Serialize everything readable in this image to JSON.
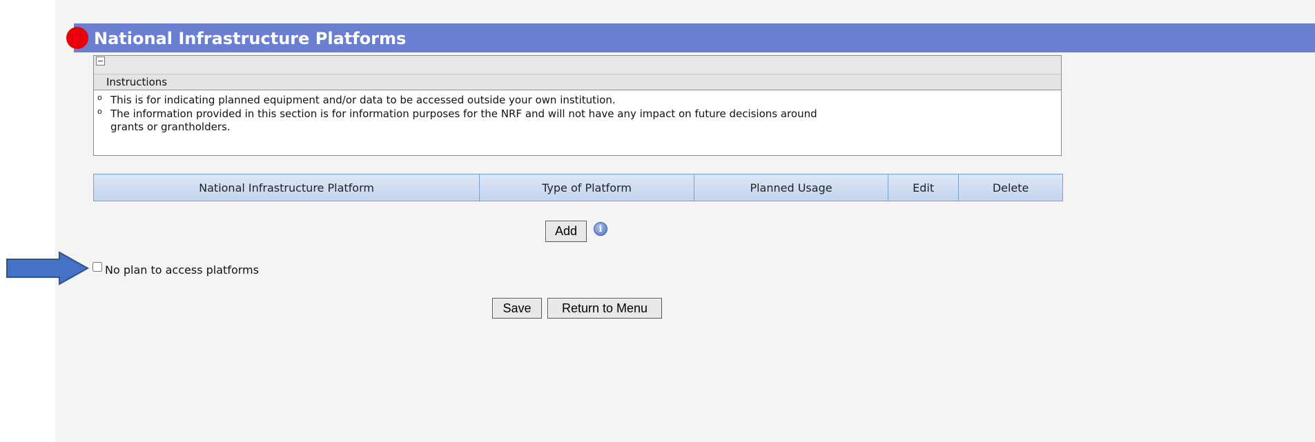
{
  "header": {
    "title": "National Infrastructure Platforms"
  },
  "instructions": {
    "heading": "Instructions",
    "items": [
      "This is for indicating planned equipment and/or data to be accessed outside your own institution.",
      "The information provided in this section is for information purposes for the NRF and will not have any impact on future decisions around",
      "grants or grantholders."
    ]
  },
  "table": {
    "columns": [
      "National Infrastructure Platform",
      "Type of Platform",
      "Planned Usage",
      "Edit",
      "Delete"
    ]
  },
  "buttons": {
    "add": "Add",
    "save": "Save",
    "return": "Return to Menu"
  },
  "checkbox": {
    "label": "No plan to access platforms",
    "checked": false
  },
  "colors": {
    "title_bar": "#6b7fd1",
    "red_dot": "#e8000b",
    "arrow": "#4472c4",
    "table_header": "#c2d4ef"
  },
  "icons": {
    "collapse": "minus-box-icon",
    "info": "info-icon",
    "arrow": "right-arrow-icon"
  }
}
